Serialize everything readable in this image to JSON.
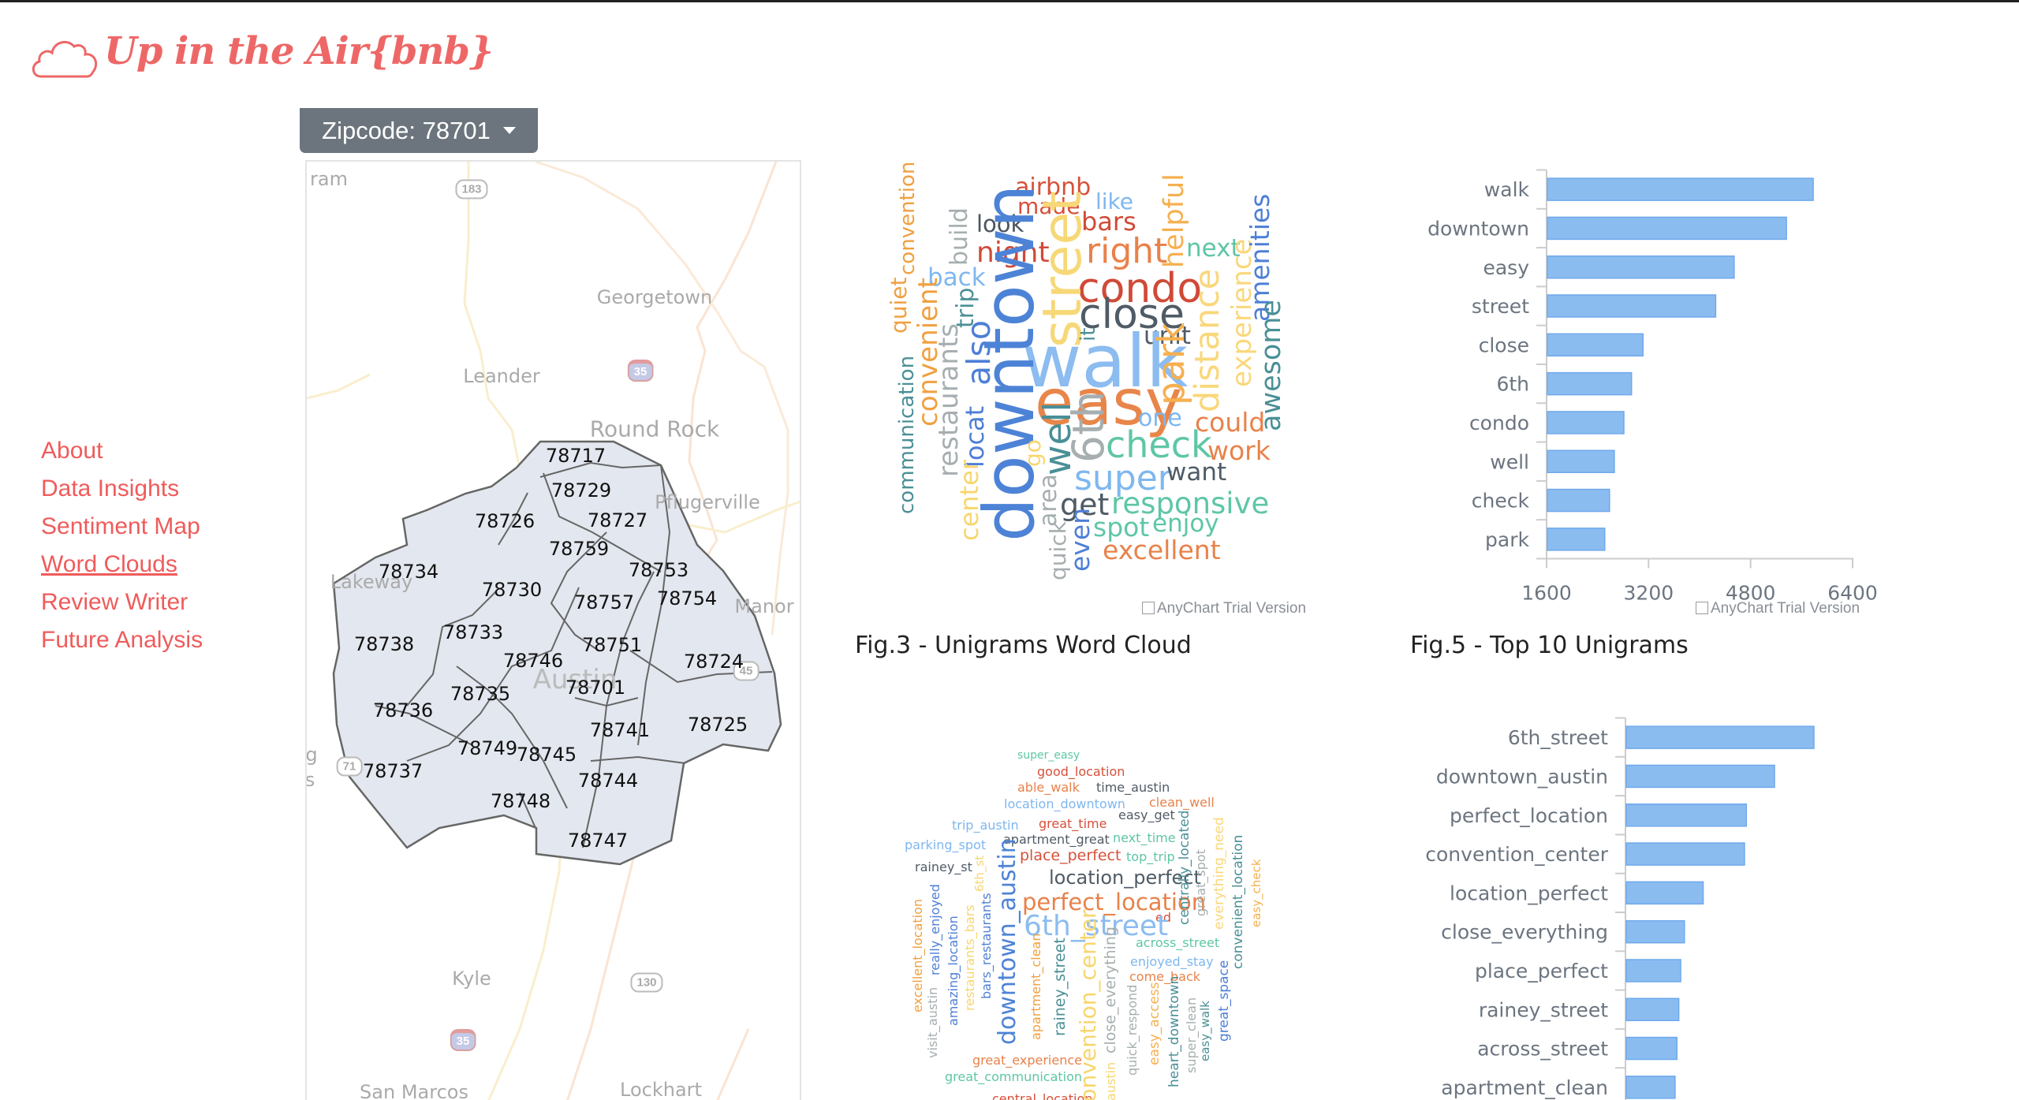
{
  "brand": {
    "title": "Up in the Air{bnb}",
    "color": "#ee6767"
  },
  "zip_dropdown": {
    "label": "Zipcode: 78701"
  },
  "sidebar": {
    "items": [
      {
        "label": "About"
      },
      {
        "label": "Data Insights"
      },
      {
        "label": "Sentiment Map"
      },
      {
        "label": "Word Clouds",
        "active": true
      },
      {
        "label": "Review Writer"
      },
      {
        "label": "Future Analysis"
      }
    ]
  },
  "map": {
    "places": [
      "ram",
      "Georgetown",
      "Leander",
      "Round Rock",
      "Pflugerville",
      "Lakeway",
      "Manor",
      "Austin",
      "Kyle",
      "San Marcos",
      "Lockhart",
      "g",
      "s"
    ],
    "highways": [
      "183",
      "35",
      "35",
      "130",
      "45",
      "71"
    ],
    "zipcodes": [
      "78717",
      "78729",
      "78726",
      "78727",
      "78759",
      "78734",
      "78753",
      "78730",
      "78757",
      "78754",
      "78733",
      "78738",
      "78751",
      "78746",
      "78724",
      "78701",
      "78735",
      "78736",
      "78725",
      "78741",
      "78749",
      "78745",
      "78737",
      "78744",
      "78748",
      "78747"
    ],
    "fill": "#e3e7ef"
  },
  "unigram_cloud": {
    "caption": "Fig.3 - Unigrams Word Cloud",
    "credit": "AnyChart Trial Version",
    "words": [
      {
        "text": "airbnb",
        "color": "#d6503a"
      },
      {
        "text": "made",
        "color": "#d6503a"
      },
      {
        "text": "like",
        "color": "#7fb7ef"
      },
      {
        "text": "bars",
        "color": "#d04a37"
      },
      {
        "text": "look",
        "color": "#4a5560"
      },
      {
        "text": "night",
        "color": "#d04a37"
      },
      {
        "text": "right",
        "color": "#e8824a"
      },
      {
        "text": "next",
        "color": "#5ec6a6"
      },
      {
        "text": "back",
        "color": "#7fb7ef"
      },
      {
        "text": "condo",
        "color": "#d04a37"
      },
      {
        "text": "close",
        "color": "#4f5b66"
      },
      {
        "text": "unit",
        "color": "#4f5b66"
      },
      {
        "text": "walk",
        "color": "#8cbcf0"
      },
      {
        "text": "easy",
        "color": "#e8864a"
      },
      {
        "text": "one",
        "color": "#7fb7ef"
      },
      {
        "text": "could",
        "color": "#e8824a"
      },
      {
        "text": "check",
        "color": "#5ec6a6"
      },
      {
        "text": "work",
        "color": "#e8824a"
      },
      {
        "text": "super",
        "color": "#7fb7ef"
      },
      {
        "text": "want",
        "color": "#4f5b66"
      },
      {
        "text": "get",
        "color": "#4f5b66"
      },
      {
        "text": "responsive",
        "color": "#5ec6a6"
      },
      {
        "text": "spot",
        "color": "#5ec6a6"
      },
      {
        "text": "enjoy",
        "color": "#5ec6a6"
      },
      {
        "text": "excellent",
        "color": "#e8824a"
      },
      {
        "text": "convention",
        "color": "#f0a040"
      },
      {
        "text": "quiet",
        "color": "#f0a040"
      },
      {
        "text": "communication",
        "color": "#4a8f96"
      },
      {
        "text": "convenient",
        "color": "#f0a040"
      },
      {
        "text": "restaurants",
        "color": "#a6aeb0"
      },
      {
        "text": "build",
        "color": "#a6aeb0"
      },
      {
        "text": "trip",
        "color": "#4a8f96"
      },
      {
        "text": "also",
        "color": "#4e7fd6"
      },
      {
        "text": "locat",
        "color": "#4e7fd6"
      },
      {
        "text": "center",
        "color": "#f7d66e"
      },
      {
        "text": "downtown",
        "color": "#4d83d6"
      },
      {
        "text": "street",
        "color": "#f7d877"
      },
      {
        "text": "it",
        "color": "#4a8f96"
      },
      {
        "text": "go",
        "color": "#f7d66e"
      },
      {
        "text": "well",
        "color": "#4a8f96"
      },
      {
        "text": "6th",
        "color": "#a6aeb0"
      },
      {
        "text": "area",
        "color": "#a6aeb0"
      },
      {
        "text": "quick",
        "color": "#a6aeb0"
      },
      {
        "text": "even",
        "color": "#4e7fd6"
      },
      {
        "text": "helpful",
        "color": "#f5b050"
      },
      {
        "text": "park",
        "color": "#f5b050"
      },
      {
        "text": "distance",
        "color": "#fad77a"
      },
      {
        "text": "experience",
        "color": "#fad77a"
      },
      {
        "text": "amenities",
        "color": "#4e7fd6"
      },
      {
        "text": "awesome",
        "color": "#4a8f96"
      }
    ]
  },
  "bigram_cloud": {
    "words": [
      {
        "text": "super_easy",
        "color": "#5ec6a6"
      },
      {
        "text": "good_location",
        "color": "#d6503a"
      },
      {
        "text": "able_walk",
        "color": "#e8824a"
      },
      {
        "text": "time_austin",
        "color": "#4f5b66"
      },
      {
        "text": "location_downtown",
        "color": "#7fb7ef"
      },
      {
        "text": "clean_well",
        "color": "#e8824a"
      },
      {
        "text": "easy_get",
        "color": "#4f5b66"
      },
      {
        "text": "trip_austin",
        "color": "#7fb7ef"
      },
      {
        "text": "great_time",
        "color": "#d6503a"
      },
      {
        "text": "apartment_great",
        "color": "#4f5b66"
      },
      {
        "text": "next_time",
        "color": "#5ec6a6"
      },
      {
        "text": "parking_spot",
        "color": "#7fb7ef"
      },
      {
        "text": "place_perfect",
        "color": "#d6503a"
      },
      {
        "text": "top_trip",
        "color": "#5ec6a6"
      },
      {
        "text": "rainey_st",
        "color": "#4f5b66"
      },
      {
        "text": "location_perfect",
        "color": "#4f5b66"
      },
      {
        "text": "perfect_location",
        "color": "#e8824a"
      },
      {
        "text": "ed",
        "color": "#d6503a"
      },
      {
        "text": "6th_street",
        "color": "#8cbcf0"
      },
      {
        "text": "across_street",
        "color": "#5ec6a6"
      },
      {
        "text": "enjoyed_stay",
        "color": "#7fb7ef"
      },
      {
        "text": "come_back",
        "color": "#e8824a"
      },
      {
        "text": "great_experience",
        "color": "#e8824a"
      },
      {
        "text": "great_communication",
        "color": "#5ec6a6"
      },
      {
        "text": "central_location",
        "color": "#d6503a"
      },
      {
        "text": "6th_st",
        "color": "#f7d66e"
      },
      {
        "text": "excellent_location",
        "color": "#f0a040"
      },
      {
        "text": "really_enjoyed",
        "color": "#4e7fd6"
      },
      {
        "text": "visit_austin",
        "color": "#a6aeb0"
      },
      {
        "text": "amazing_location",
        "color": "#4e7fd6"
      },
      {
        "text": "restaurants_bars",
        "color": "#f7d66e"
      },
      {
        "text": "bars_restaurants",
        "color": "#4e7fd6"
      },
      {
        "text": "downtown_austin",
        "color": "#4d83d6"
      },
      {
        "text": "apartment_clean",
        "color": "#f0a040"
      },
      {
        "text": "rainey_street",
        "color": "#4a8f96"
      },
      {
        "text": "convention_center",
        "color": "#f7d66e"
      },
      {
        "text": "close_everything",
        "color": "#a6aeb0"
      },
      {
        "text": "austin",
        "color": "#f7d66e"
      },
      {
        "text": "quick_respond",
        "color": "#a6aeb0"
      },
      {
        "text": "easy_access",
        "color": "#f5b050"
      },
      {
        "text": "heart_downtown",
        "color": "#4a8f96"
      },
      {
        "text": "super_clean",
        "color": "#a6aeb0"
      },
      {
        "text": "easy_walk",
        "color": "#4a8f96"
      },
      {
        "text": "great_space",
        "color": "#4e7fd6"
      },
      {
        "text": "centrally_located",
        "color": "#4a8f96"
      },
      {
        "text": "great_spot",
        "color": "#a6aeb0"
      },
      {
        "text": "everything_need",
        "color": "#fad77a"
      },
      {
        "text": "convenient_location",
        "color": "#4a8f96"
      },
      {
        "text": "easy_check",
        "color": "#f5b050"
      }
    ]
  },
  "chart_data": [
    {
      "type": "bar",
      "orientation": "horizontal",
      "title": "Fig.5 - Top 10 Unigrams",
      "credit": "AnyChart Trial Version",
      "categories": [
        "walk",
        "downtown",
        "easy",
        "street",
        "close",
        "6th",
        "condo",
        "well",
        "check",
        "park"
      ],
      "values": [
        5770,
        5350,
        4530,
        4240,
        3100,
        2920,
        2800,
        2650,
        2575,
        2500
      ],
      "xlim": [
        1600,
        6400
      ],
      "xticks": [
        "1600",
        "3200",
        "4800",
        "6400"
      ],
      "bar_color": "#8bbcf0",
      "grid": false
    },
    {
      "type": "bar",
      "orientation": "horizontal",
      "categories": [
        "6th_street",
        "downtown_austin",
        "perfect_location",
        "convention_center",
        "location_perfect",
        "close_everything",
        "place_perfect",
        "rainey_street",
        "across_street",
        "apartment_clean"
      ],
      "values": [
        100,
        79,
        64,
        63,
        41,
        31,
        29,
        28,
        27,
        26
      ],
      "bar_color": "#8bbcf0",
      "grid": false
    }
  ]
}
